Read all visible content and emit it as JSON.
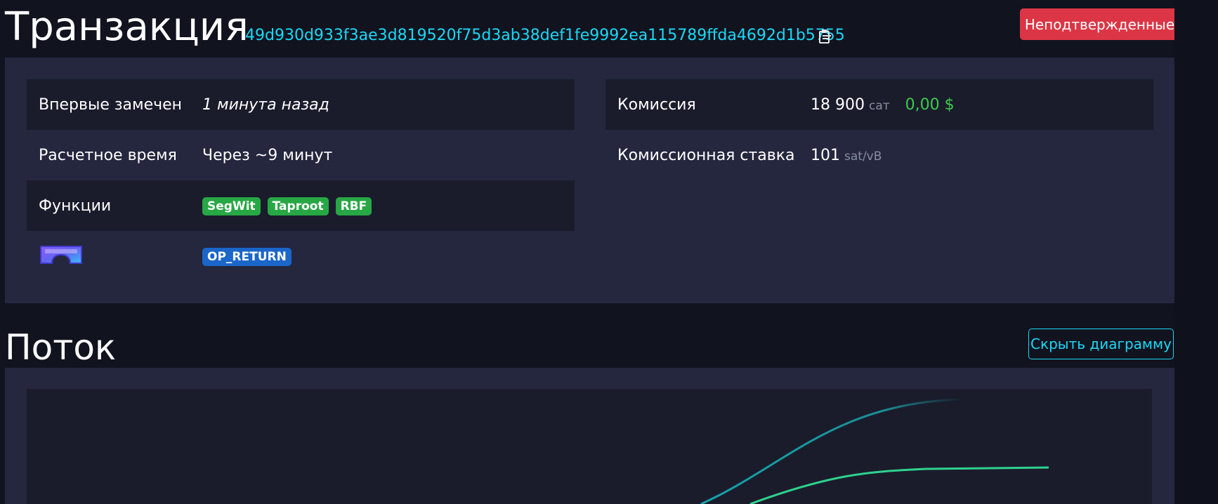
{
  "header": {
    "title": "Транзакция",
    "txid": "49d930d933f3ae3d819520f75d3ab38def1fe9992ea115789ffda4692d1b5755",
    "status": "Неподтвержденные"
  },
  "details": {
    "left": {
      "first_seen_label": "Впервые замечен",
      "first_seen_value": "1 минута назад",
      "eta_label": "Расчетное время",
      "eta_value": "Через ~9 минут",
      "features_label": "Функции",
      "features": [
        "SegWit",
        "Taproot",
        "RBF"
      ],
      "extra_badge": "OP_RETURN"
    },
    "right": {
      "fee_label": "Комиссия",
      "fee_value": "18 900",
      "fee_unit": "сат",
      "fee_fiat": "0,00 $",
      "fee_rate_label": "Комиссионная ставка",
      "fee_rate_value": "101",
      "fee_rate_unit": "sat/vB"
    }
  },
  "flow": {
    "title": "Поток",
    "hide_button": "Скрыть диаграмму"
  },
  "colors": {
    "accent": "#1bd8f4",
    "danger": "#dc3545",
    "success": "#28a745",
    "info": "#1a66c9",
    "fiat": "#3bcc49"
  },
  "icons": [
    "copy-icon",
    "goggles-icon"
  ]
}
